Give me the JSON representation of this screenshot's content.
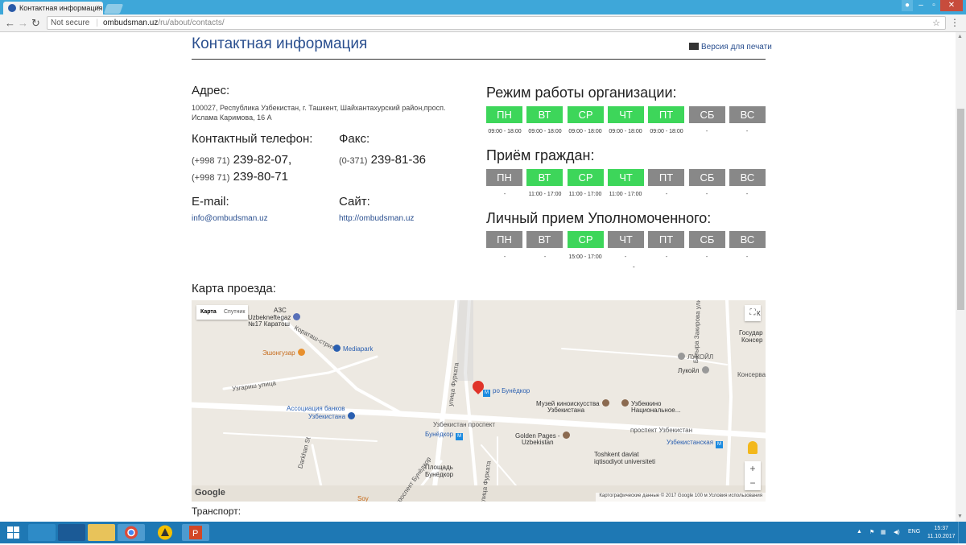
{
  "browser": {
    "tab_title": "Контактная информация",
    "tab_close": "×",
    "url_security": "Not secure",
    "url_domain": "ombudsman.uz",
    "url_path": "/ru/about/contacts/"
  },
  "page": {
    "title": "Контактная информация",
    "print_label": "Версия для печати"
  },
  "address": {
    "label": "Адрес:",
    "line1": "100027, Республика Узбекистан, г. Ташкент, Шайхантахурский район,просп.",
    "line2": "Ислама Каримова, 16 А"
  },
  "phone": {
    "label": "Контактный телефон:",
    "items": [
      {
        "prefix": "(+998 71)",
        "number": "239-82-07",
        "suffix": ","
      },
      {
        "prefix": "(+998 71)",
        "number": "239-80-71",
        "suffix": ""
      }
    ]
  },
  "fax": {
    "label": "Факс:",
    "prefix": "(0-371)",
    "number": "239-81-36"
  },
  "email": {
    "label": "E-mail:",
    "value": "info@ombudsman.uz"
  },
  "site": {
    "label": "Сайт:",
    "value": "http://ombudsman.uz"
  },
  "schedules": [
    {
      "title": "Режим работы организации:",
      "days": [
        {
          "label": "ПН",
          "active": true,
          "time": "09:00 - 18:00"
        },
        {
          "label": "ВТ",
          "active": true,
          "time": "09:00 - 18:00"
        },
        {
          "label": "СР",
          "active": true,
          "time": "09:00 - 18:00"
        },
        {
          "label": "ЧТ",
          "active": true,
          "time": "09:00 - 18:00"
        },
        {
          "label": "ПТ",
          "active": true,
          "time": "09:00 - 18:00"
        },
        {
          "label": "СБ",
          "active": false,
          "time": "-"
        },
        {
          "label": "ВС",
          "active": false,
          "time": "-"
        }
      ]
    },
    {
      "title": "Приём граждан:",
      "days": [
        {
          "label": "ПН",
          "active": false,
          "time": "-"
        },
        {
          "label": "ВТ",
          "active": true,
          "time": "11:00 - 17:00"
        },
        {
          "label": "СР",
          "active": true,
          "time": "11:00 - 17:00"
        },
        {
          "label": "ЧТ",
          "active": true,
          "time": "11:00 - 17:00"
        },
        {
          "label": "ПТ",
          "active": false,
          "time": "-"
        },
        {
          "label": "СБ",
          "active": false,
          "time": "-"
        },
        {
          "label": "ВС",
          "active": false,
          "time": "-"
        }
      ]
    },
    {
      "title": "Личный прием Уполномоченного:",
      "days": [
        {
          "label": "ПН",
          "active": false,
          "time": "-"
        },
        {
          "label": "ВТ",
          "active": false,
          "time": "-"
        },
        {
          "label": "СР",
          "active": true,
          "time": "15:00 - 17:00"
        },
        {
          "label": "ЧТ",
          "active": false,
          "time": "-"
        },
        {
          "label": "ПТ",
          "active": false,
          "time": "-"
        },
        {
          "label": "СБ",
          "active": false,
          "time": "-"
        },
        {
          "label": "ВС",
          "active": false,
          "time": "-"
        }
      ]
    }
  ],
  "extra_dash": "-",
  "map": {
    "section_label": "Карта проезда:",
    "type_map": "Карта",
    "type_satellite": "Спутник",
    "zoom_in": "+",
    "zoom_out": "−",
    "labels": {
      "azs": "АЗС",
      "uzbekneftegaz": "Uzbekneftegaz",
      "no17": "№17 Каратош",
      "karatash": "Кораташ-стрит",
      "mediapark": "Mediapark",
      "eshongu": "Эшонгузар",
      "uzgarish": "Узгариш улица",
      "assoc1": "Ассоциация банков",
      "assoc2": "Узбекистана",
      "darkhan": "Darkhan St",
      "ulica_furkata": "улица Фурката",
      "bunyodkor_top": "ро Бунёдкор",
      "museum1": "Музей киноискусства",
      "museum2": "Узбекистана",
      "uzbekkino1": "Узбеккино",
      "uzbekkino2": "Национальное...",
      "uzb_prospekt": "Узбекистан проспект",
      "prospekt_uzb": "проспект Узбекистан",
      "bunyodkor_metro": "Бунёдкор",
      "golden1": "Golden Pages -",
      "golden2": "Uzbekistan",
      "tashkent1": "Toshkent davlat",
      "tashkent2": "iqtisodiyot universiteti",
      "uzbekistanskaya": "Узбекистанская",
      "ploshad1": "Площадь",
      "ploshad2": "Бунёдкор",
      "lukoil1": "ЛУКОЙЛ",
      "lukoil2": "Лукойл",
      "gosud1": "Государ",
      "gosud2": "Консер",
      "konserva": "Консерва",
      "batyra": "Батыра Закирова улица",
      "soy": "Soy",
      "prospekt_bun": "проспект Бунёдкор",
      "ulica_furkata2": "улица Фурката",
      "kl": "К"
    },
    "google": "Google",
    "attribution": "Картографические данные © 2017 Google    100 м           Условия использования"
  },
  "transport_label": "Транспорт:",
  "tray": {
    "lang": "ENG",
    "time": "15:37",
    "date": "11.10.2017"
  }
}
